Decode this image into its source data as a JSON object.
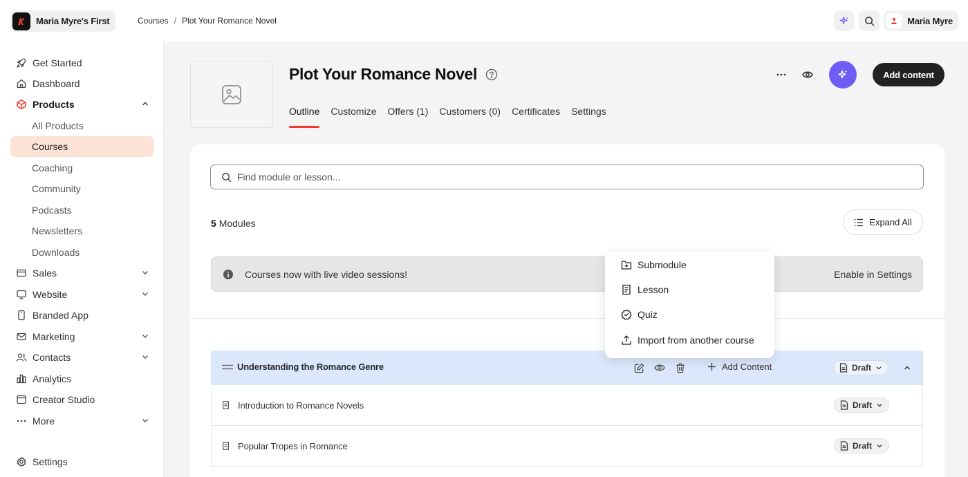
{
  "brand": {
    "name": "Maria Myre's First"
  },
  "breadcrumb": {
    "root": "Courses",
    "separator": "/",
    "current": "Plot Your Romance Novel"
  },
  "user": {
    "name": "Maria Myre"
  },
  "sidebar": {
    "items": [
      {
        "label": "Get Started",
        "icon": "rocket-icon"
      },
      {
        "label": "Dashboard",
        "icon": "home-icon"
      },
      {
        "label": "Products",
        "icon": "cube-icon",
        "expanded": true
      },
      {
        "label": "Sales",
        "icon": "card-icon"
      },
      {
        "label": "Website",
        "icon": "monitor-icon"
      },
      {
        "label": "Branded App",
        "icon": "phone-icon"
      },
      {
        "label": "Marketing",
        "icon": "mail-icon"
      },
      {
        "label": "Contacts",
        "icon": "users-icon"
      },
      {
        "label": "Analytics",
        "icon": "chart-icon"
      },
      {
        "label": "Creator Studio",
        "icon": "studio-icon"
      },
      {
        "label": "More",
        "icon": "dots-icon"
      },
      {
        "label": "Settings",
        "icon": "gear-icon"
      }
    ],
    "products_sub": [
      "All Products",
      "Courses",
      "Coaching",
      "Community",
      "Podcasts",
      "Newsletters",
      "Downloads"
    ],
    "active_sub": "Courses"
  },
  "course": {
    "title": "Plot Your Romance Novel",
    "tabs": [
      "Outline",
      "Customize",
      "Offers (1)",
      "Customers (0)",
      "Certificates",
      "Settings"
    ],
    "active_tab": "Outline",
    "add_content_label": "Add content"
  },
  "outline": {
    "search_placeholder": "Find module or lesson...",
    "modules_count": "5",
    "modules_label": "Modules",
    "expand_label": "Expand All",
    "banner_text": "Courses now with live video sessions!",
    "banner_action": "Enable in Settings",
    "module": {
      "title": "Understanding the Romance Genre",
      "add_label": "Add Content",
      "status": "Draft"
    },
    "lessons": [
      {
        "title": "Introduction to Romance Novels",
        "status": "Draft"
      },
      {
        "title": "Popular Tropes in Romance",
        "status": "Draft"
      }
    ]
  },
  "dropdown": {
    "items": [
      {
        "label": "Submodule",
        "icon": "folder-plus-icon"
      },
      {
        "label": "Lesson",
        "icon": "document-icon"
      },
      {
        "label": "Quiz",
        "icon": "badge-check-icon"
      },
      {
        "label": "Import from another course",
        "icon": "upload-icon"
      }
    ]
  },
  "colors": {
    "accent": "#ef3b2d",
    "ai": "#6f5cf6",
    "active_sub_bg": "#fde3d6",
    "module_bg": "#dbe7fb"
  }
}
